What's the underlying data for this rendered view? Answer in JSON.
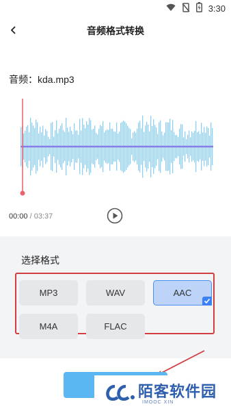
{
  "status_bar": {
    "time": "3:30",
    "icons": [
      "wifi-icon",
      "no-sim-icon",
      "battery-icon"
    ]
  },
  "header": {
    "back_icon": "chevron-left-icon",
    "title": "音频格式转换"
  },
  "audio": {
    "name_label": "音频：kda.mp3",
    "current_time": "00:00",
    "separator": "/",
    "total_time": "03:37",
    "playhead_progress": 0,
    "play_icon": "play-icon"
  },
  "format_section": {
    "title": "选择格式",
    "options": [
      {
        "label": "MP3",
        "selected": false
      },
      {
        "label": "WAV",
        "selected": false
      },
      {
        "label": "AAC",
        "selected": true
      },
      {
        "label": "M4A",
        "selected": false
      },
      {
        "label": "FLAC",
        "selected": false
      }
    ]
  },
  "watermark": {
    "text": "陌客软件园",
    "sub": "IMOOC XIN"
  },
  "colors": {
    "accent": "#3b82f6",
    "waveform": "#8fd0f2",
    "playhead": "#e8646a",
    "highlight_box": "#d23d3f",
    "convert_button": "#5ab7f1",
    "selected_bg": "#bdd3f7"
  }
}
